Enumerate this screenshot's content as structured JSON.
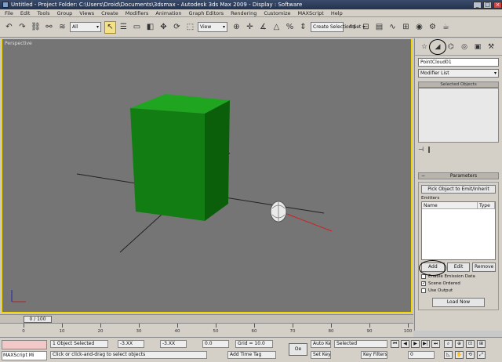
{
  "window": {
    "title": "Untitled   - Project Folder: C:\\Users\\Droid\\Documents\\3dsmax   - Autodesk 3ds Max  2009   - Display : Software"
  },
  "menu": [
    "File",
    "Edit",
    "Tools",
    "Group",
    "Views",
    "Create",
    "Modifiers",
    "Animation",
    "Graph Editors",
    "Rendering",
    "Customize",
    "MAXScript",
    "Help"
  ],
  "toolbar": {
    "selection_filter": "All",
    "ref_coord": "View",
    "named_selection": "Create Selection Set"
  },
  "viewport": {
    "label": "Perspective",
    "box_color": "#127d12",
    "frame_color": "#f1d400"
  },
  "command_panel": {
    "object_name": "PointCloud01",
    "modifier_list": "Modifier List",
    "stack_header": "Selected Objects",
    "parameters_title": "Parameters",
    "pick_button": "Pick Object to Emit/Inherit",
    "list_label": "Emitters",
    "col_name": "Name",
    "col_type": "Type",
    "add_button": "Add",
    "edit_button": "Edit",
    "remove_button": "Remove",
    "check1": "Enable Emission Data",
    "check2": "Scene Ordered",
    "check3": "Use Output",
    "big_button": "Load Now"
  },
  "timeline": {
    "slider": "0 / 100",
    "ticks": [
      "0",
      "10",
      "20",
      "30",
      "40",
      "50",
      "60",
      "70",
      "80",
      "90",
      "100"
    ]
  },
  "status": {
    "maxscript": "MAXScript Mi",
    "selected": "1 Object Selected",
    "prompt": "Click or click-and-drag to select objects",
    "x": "-3.XX",
    "y": "-3.XX",
    "z": "0.0",
    "grid": "Grid = 10.0",
    "autokey": "Auto Key",
    "key_filter": "Selected",
    "set_key": "Set Key",
    "key_filters": "Key Filters...",
    "frame": "0",
    "add_time_tag": "Add Time Tag"
  }
}
